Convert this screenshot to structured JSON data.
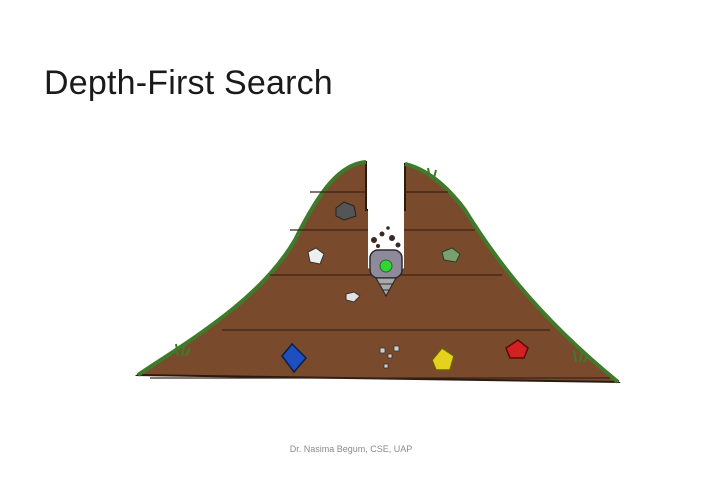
{
  "slide": {
    "title": "Depth-First Search",
    "footer": "Dr. Nasima Begum, CSE, UAP"
  },
  "illustration": {
    "subject": "drill robot digging straight down through a layered dirt hill toward buried gems",
    "colors": {
      "dirt": "#7a4a2c",
      "dirt_lines": "#3b2416",
      "grass": "#3f7a2a",
      "gem_blue": "#1f4fbf",
      "gem_yellow": "#e6d21c",
      "gem_red": "#d42020",
      "robot_body": "#8e8a9c",
      "robot_light": "#35d435"
    }
  }
}
